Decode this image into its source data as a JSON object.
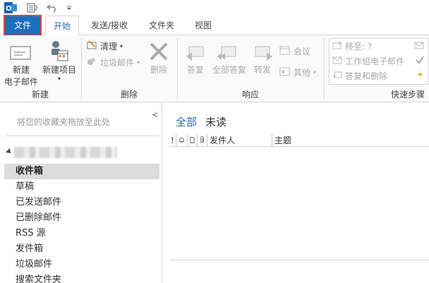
{
  "quick_access": {
    "outlook_icon": "outlook-logo-icon",
    "sendreceive_icon": "send-receive-icon",
    "undo_icon": "undo-icon",
    "customize_icon": "customize-quick-access-icon"
  },
  "tabs": [
    {
      "label": "文件"
    },
    {
      "label": "开始"
    },
    {
      "label": "发送/接收"
    },
    {
      "label": "文件夹"
    },
    {
      "label": "视图"
    }
  ],
  "ribbon": {
    "new_group": {
      "new_email_line1": "新建",
      "new_email_line2": "电子邮件",
      "new_items": "新建项目",
      "label": "新建"
    },
    "delete_group": {
      "clean_up": "清理",
      "junk": "垃圾邮件",
      "delete": "删除",
      "label": "删除"
    },
    "respond_group": {
      "reply": "答复",
      "reply_all": "全部答复",
      "forward": "转发",
      "meeting": "会议",
      "more": "其他",
      "label": "响应"
    },
    "quicksteps_group": {
      "move_to": "移至: ?",
      "team_email": "工作组电子邮件",
      "reply_delete": "答复和删除",
      "label": "快速步骤"
    }
  },
  "left_pane": {
    "favorites_hint": "将您的收藏夹拖放至此处",
    "folders": [
      "收件箱",
      "草稿",
      "已发送邮件",
      "已删除邮件",
      "RSS 源",
      "发件箱",
      "垃圾邮件",
      "搜索文件夹"
    ]
  },
  "main_pane": {
    "filter_all": "全部",
    "filter_unread": "未读",
    "columns": {
      "importance": "!",
      "from": "发件人",
      "subject": "主题"
    }
  },
  "colors": {
    "accent": "#2b6cb5",
    "file_tab_bg": "#1a6fbf",
    "highlight_outline": "#e04040",
    "selected_folder_bg": "#dcdcdc"
  }
}
